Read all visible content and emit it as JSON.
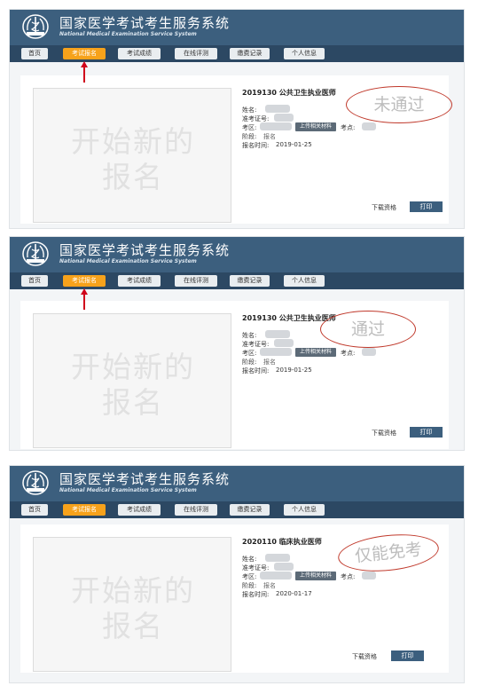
{
  "app": {
    "title": "国家医学考试考生服务系统",
    "subtitle": "National Medical Examination Service System"
  },
  "nav": [
    "首页",
    "考试报名",
    "考试成绩",
    "在线评测",
    "缴费记录",
    "个人信息"
  ],
  "placeholder_text": "开始新的报名",
  "labels": {
    "name": "姓名:",
    "ticket": "准考证号:",
    "area": "考区:",
    "site": "考点:",
    "stage": "阶段:",
    "time": "报名时间:",
    "upload": "上传相关材料",
    "download": "下载资格",
    "print": "打印"
  },
  "records": [
    {
      "exam": "2019130 公共卫生执业医师",
      "stage": "报名",
      "date": "2019-01-25",
      "stamp": "未通过"
    },
    {
      "exam": "2019130 公共卫生执业医师",
      "stage": "报名",
      "date": "2019-01-25",
      "stamp": "通过"
    },
    {
      "exam": "2020110 临床执业医师",
      "stage": "报名",
      "date": "2020-01-17",
      "stamp": "仅能免考"
    }
  ],
  "colors": {
    "header": "#3c5f7e",
    "navbar": "#2c4863",
    "active_tab": "#f7a21b",
    "stamp_ring": "#c0392b",
    "arrow": "#d0021b"
  }
}
